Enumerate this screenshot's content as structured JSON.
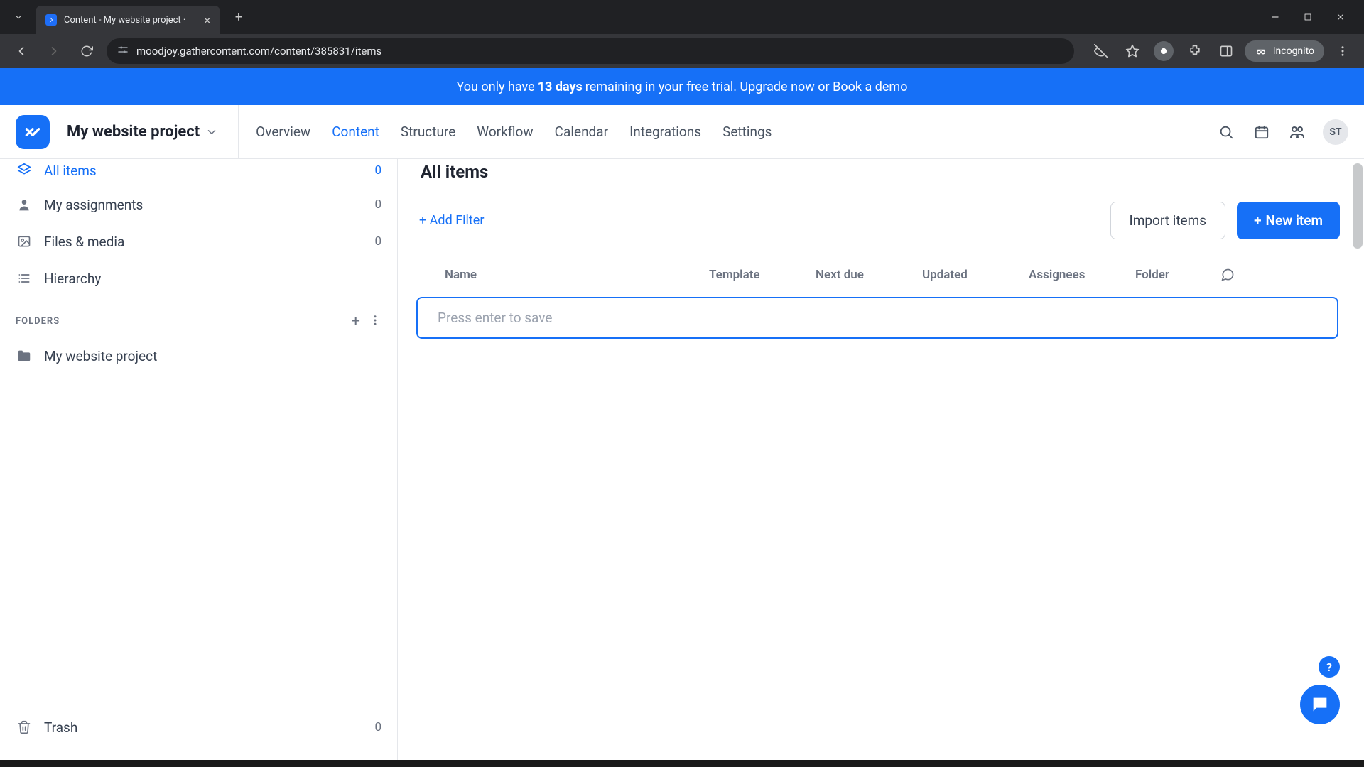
{
  "browser": {
    "tab_title": "Content - My website project ·",
    "url": "moodjoy.gathercontent.com/content/385831/items",
    "incognito_label": "Incognito"
  },
  "banner": {
    "prefix": "You only have",
    "days": "13 days",
    "middle": "remaining in your free trial.",
    "upgrade": "Upgrade now",
    "or": "or",
    "book": "Book a demo"
  },
  "header": {
    "project_name": "My website project",
    "tabs": {
      "overview": "Overview",
      "content": "Content",
      "structure": "Structure",
      "workflow": "Workflow",
      "calendar": "Calendar",
      "integrations": "Integrations",
      "settings": "Settings"
    },
    "user_initials": "ST"
  },
  "sidebar": {
    "all_items": {
      "label": "All items",
      "count": "0"
    },
    "my_assignments": {
      "label": "My assignments",
      "count": "0"
    },
    "files_media": {
      "label": "Files & media",
      "count": "0"
    },
    "hierarchy": {
      "label": "Hierarchy"
    },
    "folders_title": "FOLDERS",
    "folder1": {
      "label": "My website project"
    },
    "trash": {
      "label": "Trash",
      "count": "0"
    }
  },
  "main": {
    "title": "All items",
    "add_filter": "+ Add Filter",
    "import_items": "Import items",
    "new_item": "New item",
    "columns": {
      "name": "Name",
      "template": "Template",
      "next_due": "Next due",
      "updated": "Updated",
      "assignees": "Assignees",
      "folder": "Folder"
    },
    "new_item_placeholder": "Press enter to save"
  }
}
